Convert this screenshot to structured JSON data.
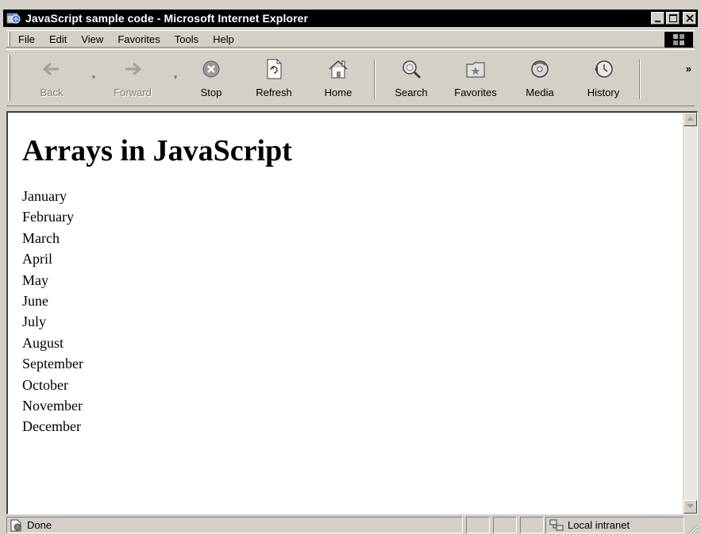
{
  "window": {
    "title": "JavaScript sample code - Microsoft Internet Explorer"
  },
  "menu": {
    "items": [
      {
        "label": "File"
      },
      {
        "label": "Edit"
      },
      {
        "label": "View"
      },
      {
        "label": "Favorites"
      },
      {
        "label": "Tools"
      },
      {
        "label": "Help"
      }
    ]
  },
  "toolbar": {
    "buttons": [
      {
        "label": "Back",
        "icon": "back-arrow-icon",
        "enabled": false
      },
      {
        "label": "Forward",
        "icon": "forward-arrow-icon",
        "enabled": false
      },
      {
        "label": "Stop",
        "icon": "stop-icon",
        "enabled": true
      },
      {
        "label": "Refresh",
        "icon": "refresh-icon",
        "enabled": true
      },
      {
        "label": "Home",
        "icon": "home-icon",
        "enabled": true
      },
      {
        "label": "Search",
        "icon": "search-icon",
        "enabled": true
      },
      {
        "label": "Favorites",
        "icon": "favorites-icon",
        "enabled": true
      },
      {
        "label": "Media",
        "icon": "media-icon",
        "enabled": true
      },
      {
        "label": "History",
        "icon": "history-icon",
        "enabled": true
      }
    ],
    "more": "»"
  },
  "page": {
    "heading": "Arrays in JavaScript",
    "months": [
      "January",
      "February",
      "March",
      "April",
      "May",
      "June",
      "July",
      "August",
      "September",
      "October",
      "November",
      "December"
    ]
  },
  "status": {
    "text": "Done",
    "zone": "Local intranet"
  }
}
